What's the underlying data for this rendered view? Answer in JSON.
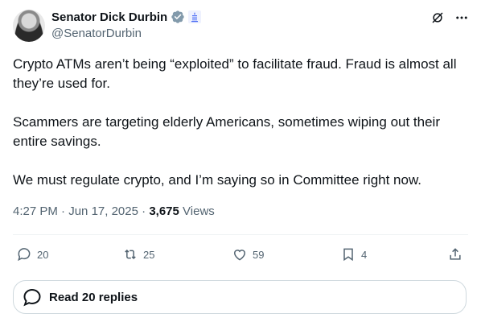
{
  "author": {
    "name": "Senator Dick Durbin",
    "handle": "@SenatorDurbin"
  },
  "tweet": {
    "paragraphs": [
      "Crypto ATMs aren’t being “exploited” to facilitate fraud. Fraud is almost all they’re used for.",
      "Scammers are targeting elderly Americans, sometimes wiping out their entire savings.",
      "We must regulate crypto, and I’m saying so in Committee right now."
    ],
    "time": "4:27 PM",
    "date": "Jun 17, 2025",
    "sep": "·",
    "views_count": "3,675",
    "views_label": "Views"
  },
  "actions": {
    "replies": "20",
    "reposts": "25",
    "likes": "59",
    "bookmarks": "4"
  },
  "read_replies": {
    "label": "Read 20 replies"
  },
  "colors": {
    "text": "#0f1419",
    "muted": "#536471",
    "verified": "#829aab",
    "gov_badge": "#4b6bf5",
    "border": "#cfd9de"
  }
}
